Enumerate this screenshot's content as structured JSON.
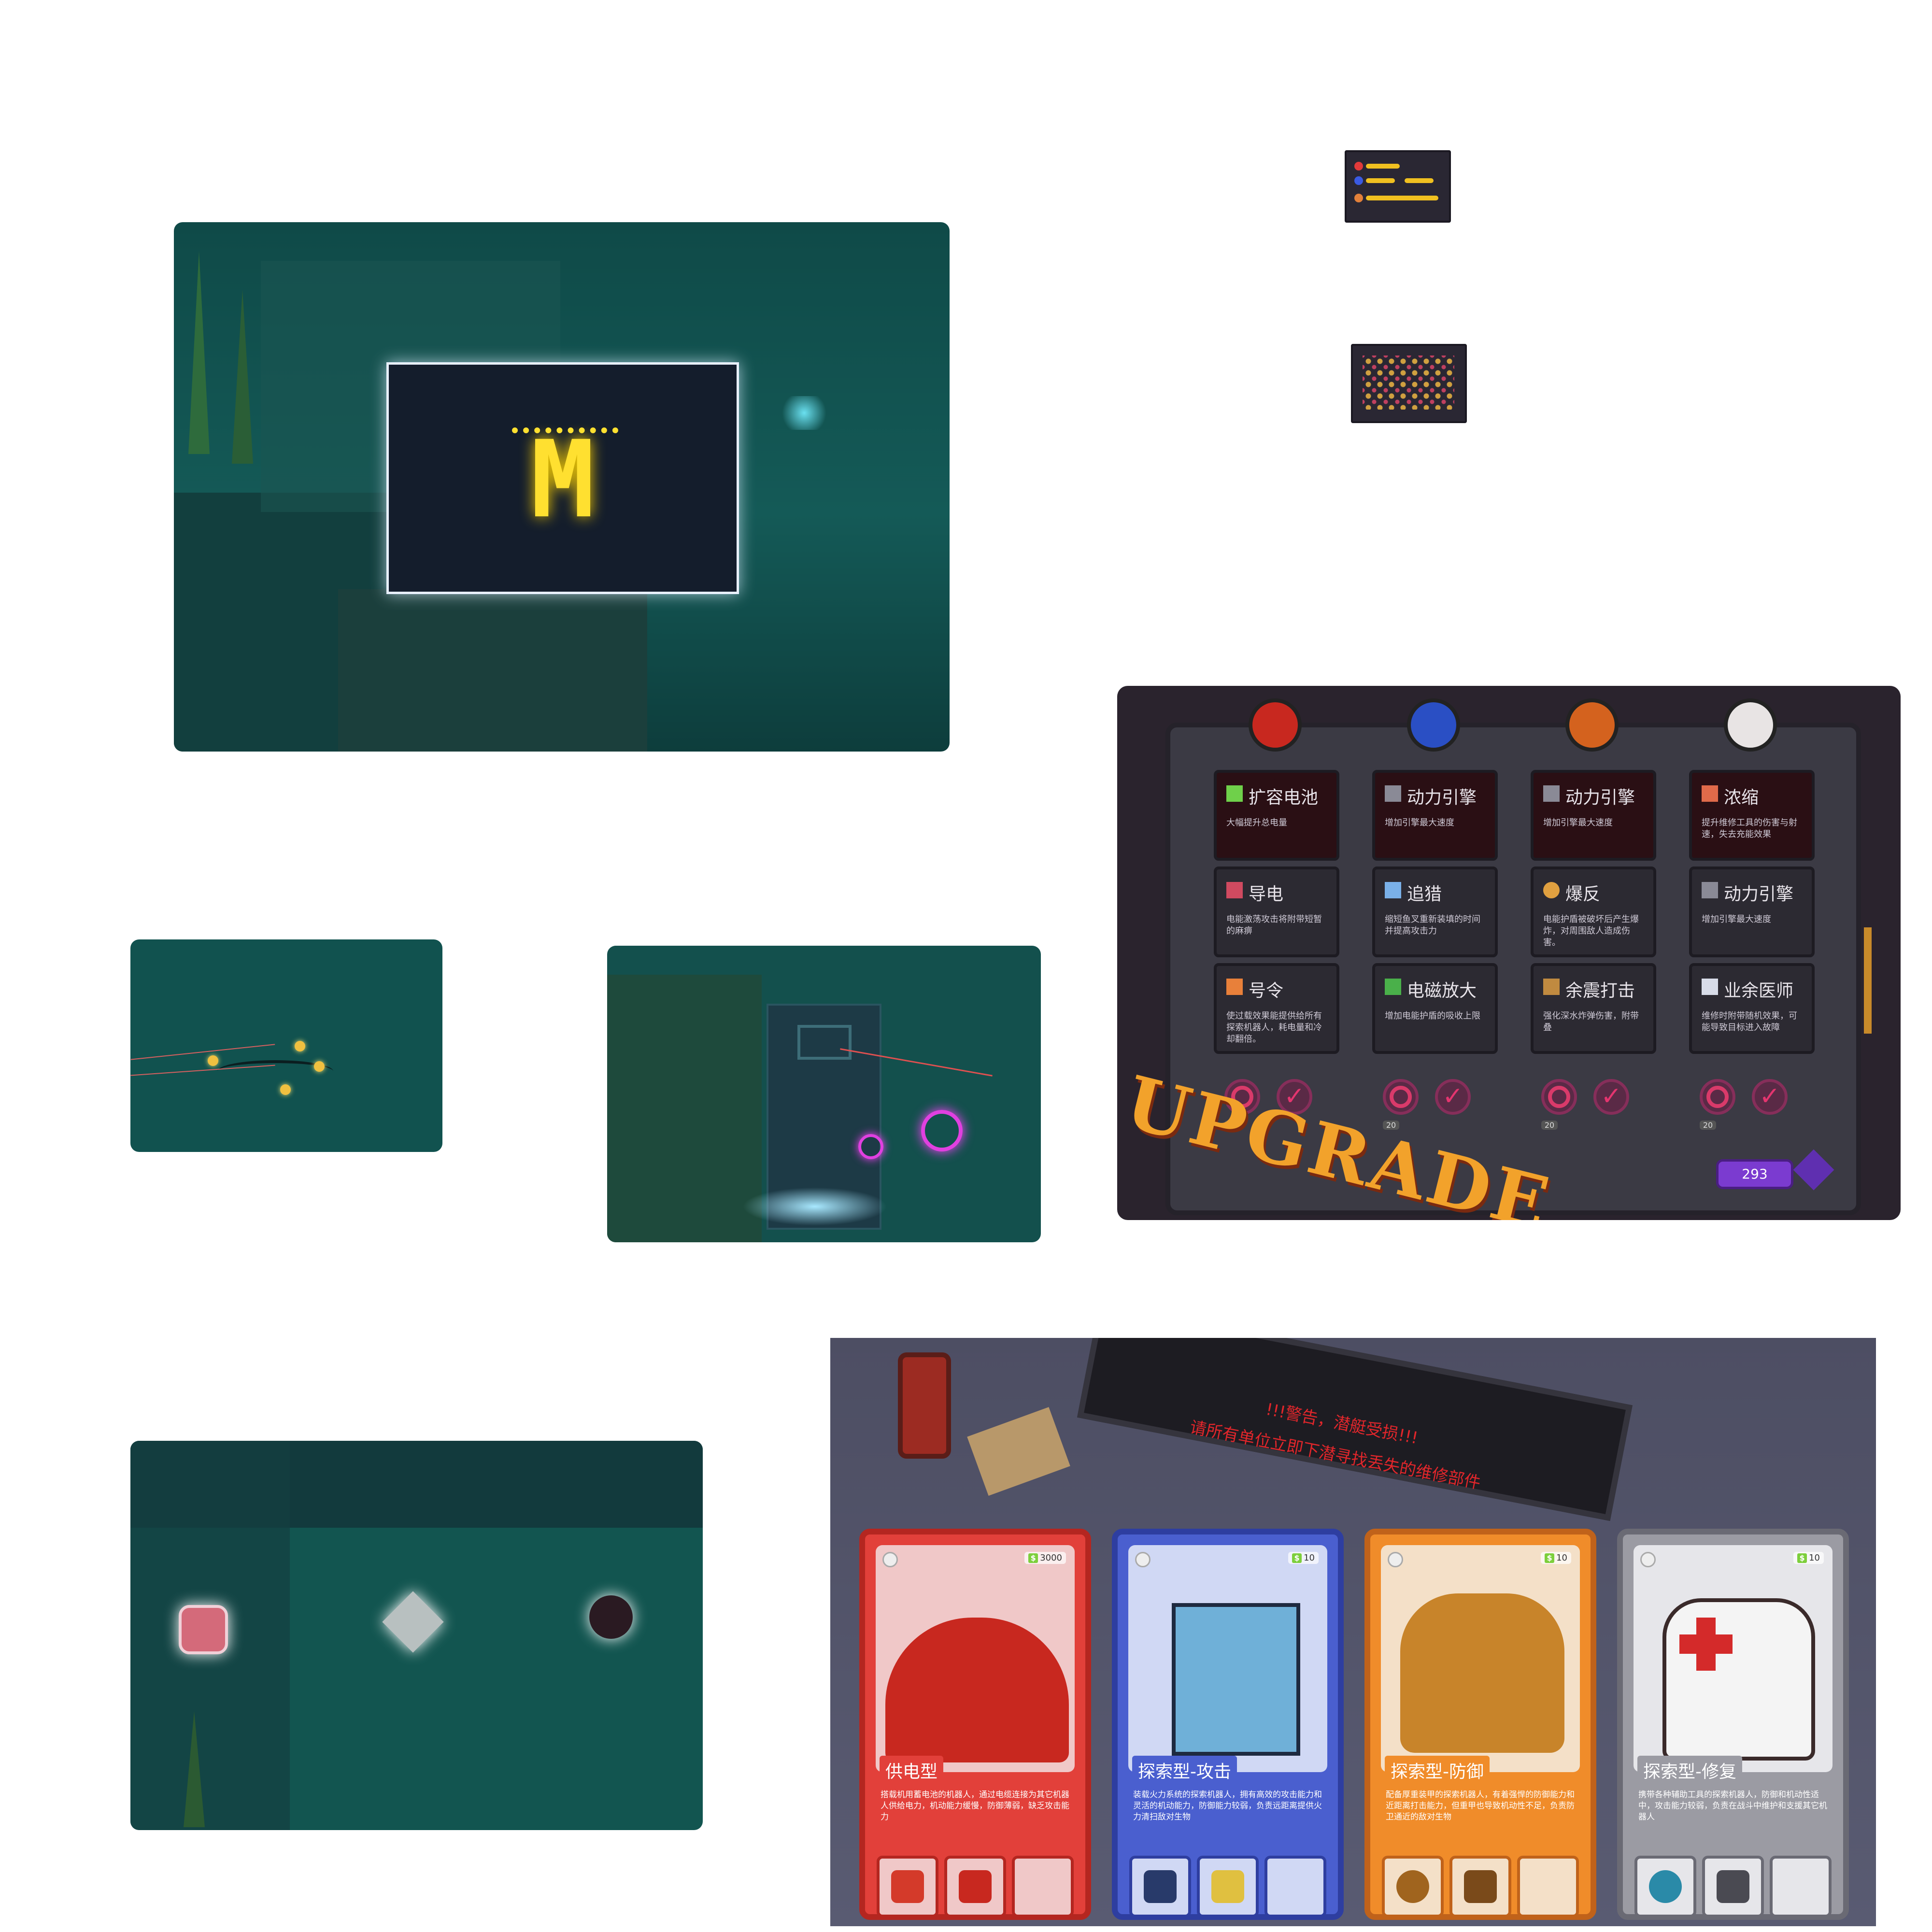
{
  "colors": {
    "sea": "#11514f",
    "sign_glow": "#ffe030",
    "upgrade_bg": "#2a232d",
    "upgrade_word": "#f2a22b",
    "warning_text": "#e0262b",
    "card_power": "#e2403a",
    "card_attack": "#4a5fcf",
    "card_defense": "#f08c2a",
    "card_repair": "#9b9ba3"
  },
  "scene_sign": {
    "logo": "M",
    "icons": [
      "coral-icon",
      "fern-icon"
    ]
  },
  "upgrade": {
    "word": "UPGRADE",
    "currency": "293",
    "columns": [
      {
        "badge_icon": "power-robot-icon",
        "badge_color": "#c8281f",
        "cost": "20",
        "cards": [
          {
            "title": "扩容电池",
            "desc": "大幅提升总电量",
            "icon": "battery-icon"
          },
          {
            "title": "导电",
            "desc": "电能激荡攻击将附带短暂的麻痹",
            "icon": "conduct-icon"
          },
          {
            "title": "号令",
            "desc": "使过载效果能提供给所有探索机器人，耗电量和冷却翻倍。",
            "icon": "command-icon"
          }
        ]
      },
      {
        "badge_icon": "attack-robot-icon",
        "badge_color": "#2a4fc4",
        "cost": "20",
        "cards": [
          {
            "title": "动力引擎",
            "desc": "增加引擎最大速度",
            "icon": "engine-icon"
          },
          {
            "title": "追猎",
            "desc": "缩短鱼叉重新装填的时间并提高攻击力",
            "icon": "harpoon-icon"
          },
          {
            "title": "电磁放大",
            "desc": "增加电能护盾的吸收上限",
            "icon": "magnet-icon"
          }
        ]
      },
      {
        "badge_icon": "defense-robot-icon",
        "badge_color": "#d4621e",
        "cost": "20",
        "cards": [
          {
            "title": "动力引擎",
            "desc": "增加引擎最大速度",
            "icon": "engine-icon"
          },
          {
            "title": "爆反",
            "desc": "电能护盾被破坏后产生爆炸，对周围敌人造成伤害。",
            "icon": "shield-icon"
          },
          {
            "title": "余震打击",
            "desc": "强化深水炸弹伤害，附带叠",
            "icon": "quake-icon"
          }
        ]
      },
      {
        "badge_icon": "medic-robot-icon",
        "badge_color": "#e8e4e4",
        "cost": "20",
        "cards": [
          {
            "title": "浓缩",
            "desc": "提升维修工具的伤害与射速，失去充能效果",
            "icon": "concentrate-icon"
          },
          {
            "title": "动力引擎",
            "desc": "增加引擎最大速度",
            "icon": "engine-icon"
          },
          {
            "title": "业余医师",
            "desc": "维修时附带随机效果，可能导致目标进入故障",
            "icon": "medic-icon"
          }
        ]
      }
    ]
  },
  "robots": {
    "warning_line1": "!!!警告，潜艇受损!!!",
    "warning_line2": "请所有单位立即下潜寻找丢失的维修部件",
    "cards": [
      {
        "name": "供电型",
        "price": "3000",
        "desc": "搭载机用蓄电池的机器人，通过电缆连接为其它机器人供给电力，机动能力缓慢，防御薄弱，缺乏攻击能力",
        "slots": [
          "upgrade-chest-icon",
          "power-plug-icon",
          "empty-slot"
        ]
      },
      {
        "name": "探索型-攻击",
        "price": "10",
        "desc": "装载火力系统的探索机器人，拥有高效的攻击能力和灵活的机动能力，防御能力较弱，负责远距离提供火力清扫敌对生物",
        "slots": [
          "harpoon-gun-icon",
          "lightning-icon",
          "empty-slot"
        ]
      },
      {
        "name": "探索型-防御",
        "price": "10",
        "desc": "配备厚重装甲的探索机器人，有着强悍的防御能力和近距离打击能力，但重甲也导致机动性不足，负责防卫通近的敌对生物",
        "slots": [
          "bomb-icon",
          "armor-icon",
          "empty-slot"
        ]
      },
      {
        "name": "探索型-修复",
        "price": "10",
        "desc": "携带各种辅助工具的探索机器人，防御和机动性适中，攻击能力较弱，负责在战斗中维护和支援其它机器人",
        "slots": [
          "heal-orb-icon",
          "wrench-icon",
          "empty-slot"
        ]
      }
    ]
  }
}
